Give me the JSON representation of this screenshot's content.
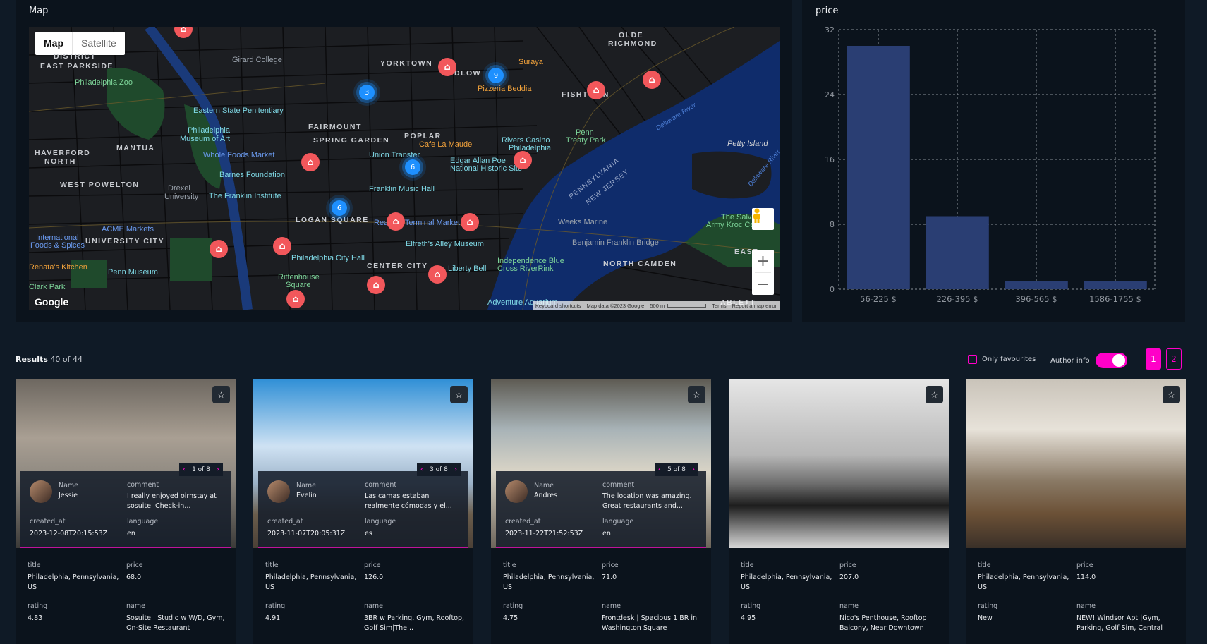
{
  "map_panel": {
    "title": "Map",
    "map_type_buttons": [
      "Map",
      "Satellite"
    ],
    "active_map_type": "Map",
    "attribution": [
      "Keyboard shortcuts",
      "Map data ©2023 Google",
      "500 m",
      "Terms",
      "Report a map error"
    ],
    "logo": "Google",
    "zoom_in": "+",
    "zoom_out": "−",
    "labels": {
      "neighborhoods": [
        "DISTRICT",
        "EAST PARKSIDE",
        "MANTUA",
        "HAVERFORD",
        "NORTH",
        "WEST POWELTON",
        "UNIVERSITY CITY",
        "FAIRMOUNT",
        "SPRING GARDEN",
        "POPLAR",
        "YORKTOWN",
        "LUDLOW",
        "FISHTOWN",
        "OLDE",
        "RICHMOND",
        "LOGAN SQUARE",
        "CENTER CITY",
        "NORTH CAMDEN",
        "ABLETT",
        "EAST"
      ],
      "pois": [
        "Girard College",
        "Philadelphia Zoo",
        "Eastern State Penitentiary",
        "Philadelphia",
        "Museum of Art",
        "Whole Foods Market",
        "Barnes Foundation",
        "The Franklin Institute",
        "Drexel",
        "University",
        "ACME Markets",
        "International",
        "Foods & Spices",
        "Renata's Kitchen",
        "Penn Museum",
        "Clark Park",
        "Suraya",
        "Pizzeria Beddia",
        "Cafe La Maude",
        "Rivers Casino",
        "Philadelphia",
        "Penn",
        "Treaty Park",
        "Union Transfer",
        "Edgar Allan Poe",
        "National Historic Site",
        "Franklin Music Hall",
        "Reading Terminal Market",
        "Elfreth's Alley Museum",
        "Philadelphia City Hall",
        "Rittenhouse",
        "Square",
        "Liberty Bell",
        "Independence Blue",
        "Cross RiverRink",
        "Weeks Marine",
        "Benjamin Franklin Bridge",
        "Adventure Aquarium",
        "The Salvation",
        "Army Kroc Center"
      ],
      "water": [
        "Delaware River",
        "Delaware River"
      ],
      "island": "Petty Island",
      "states": [
        "PENNSYLVANIA",
        "NEW JERSEY"
      ]
    },
    "clusters": [
      "3",
      "9",
      "6",
      "6"
    ]
  },
  "chart_panel": {
    "title": "price"
  },
  "chart_data": {
    "type": "bar",
    "title": "price",
    "categories": [
      "56-225 $",
      "226-395 $",
      "396-565 $",
      "1586-1755 $"
    ],
    "values": [
      30,
      9,
      1,
      1
    ],
    "xlabel": "",
    "ylabel": "",
    "ylim": [
      0,
      32
    ],
    "yticks": [
      0,
      8,
      16,
      24,
      32
    ],
    "grid": true,
    "bar_color": "#2a3e73"
  },
  "results": {
    "label": "Results",
    "count": "40 of 44",
    "only_favourites_label": "Only favourites",
    "only_favourites_checked": false,
    "author_info_label": "Author info",
    "author_info_on": true,
    "pages": [
      "1",
      "2"
    ],
    "current_page": "1"
  },
  "accent_color": "#ff00c8",
  "cards": [
    {
      "author": {
        "pager": "1 of 8",
        "name_label": "Name",
        "name": "Jessie",
        "comment_label": "comment",
        "comment": "I really enjoyed oirnstay at sosuite. Check-in...",
        "created_at_label": "created_at",
        "created_at": "2023-12-08T20:15:53Z",
        "language_label": "language",
        "language": "en"
      },
      "title_label": "title",
      "title": "Philadelphia, Pennsylvania, US",
      "price_label": "price",
      "price": "68.0",
      "rating_label": "rating",
      "rating": "4.83",
      "name_label": "name",
      "name": "Sosuite | Studio w W/D, Gym, On-Site Restaurant"
    },
    {
      "author": {
        "pager": "3 of 8",
        "name_label": "Name",
        "name": "Evelin",
        "comment_label": "comment",
        "comment": "Las camas estaban realmente cómodas y el...",
        "created_at_label": "created_at",
        "created_at": "2023-11-07T20:05:31Z",
        "language_label": "language",
        "language": "es"
      },
      "title_label": "title",
      "title": "Philadelphia, Pennsylvania, US",
      "price_label": "price",
      "price": "126.0",
      "rating_label": "rating",
      "rating": "4.91",
      "name_label": "name",
      "name": "3BR w Parking, Gym, Rooftop, Golf Sim|The..."
    },
    {
      "author": {
        "pager": "5 of 8",
        "name_label": "Name",
        "name": "Andres",
        "comment_label": "comment",
        "comment": "The location was amazing. Great restaurants and...",
        "created_at_label": "created_at",
        "created_at": "2023-11-22T21:52:53Z",
        "language_label": "language",
        "language": "en"
      },
      "title_label": "title",
      "title": "Philadelphia, Pennsylvania, US",
      "price_label": "price",
      "price": "71.0",
      "rating_label": "rating",
      "rating": "4.75",
      "name_label": "name",
      "name": "Frontdesk | Spacious 1 BR in Washington Square"
    },
    {
      "title_label": "title",
      "title": "Philadelphia, Pennsylvania, US",
      "price_label": "price",
      "price": "207.0",
      "rating_label": "rating",
      "rating": "4.95",
      "name_label": "name",
      "name": "Nico's Penthouse, Rooftop Balcony, Near Downtown"
    },
    {
      "title_label": "title",
      "title": "Philadelphia, Pennsylvania, US",
      "price_label": "price",
      "price": "114.0",
      "rating_label": "rating",
      "rating": "New",
      "name_label": "name",
      "name": "NEW! Windsor Apt |Gym, Parking, Golf Sim, Central"
    }
  ]
}
